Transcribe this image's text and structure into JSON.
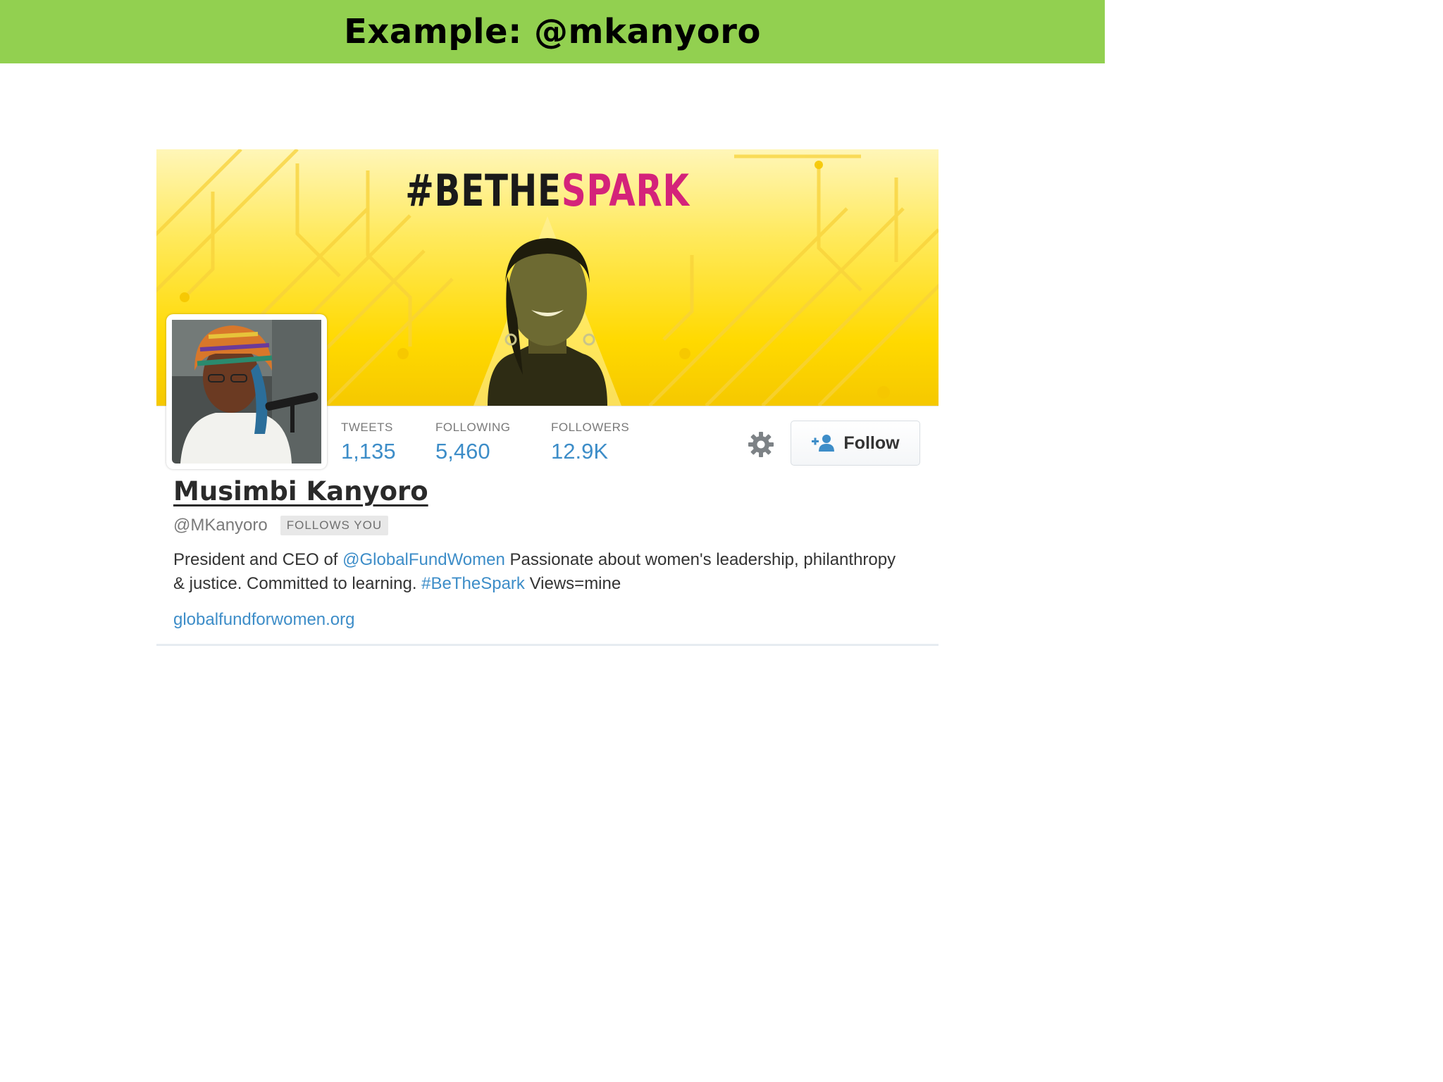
{
  "slide": {
    "title": "Example: @mkanyoro",
    "title_bar_color": "#92d050"
  },
  "banner": {
    "hashtag_dark": "#BETHE",
    "hashtag_pink": "SPARK",
    "colors": {
      "yellow": "#ffd900",
      "pink": "#d4237a"
    }
  },
  "stats": {
    "tweets": {
      "label": "TWEETS",
      "value": "1,135"
    },
    "following": {
      "label": "FOLLOWING",
      "value": "5,460"
    },
    "followers": {
      "label": "FOLLOWERS",
      "value": "12.9K"
    }
  },
  "actions": {
    "settings_icon": "gear-icon",
    "follow_icon": "add-user-icon",
    "follow_label": "Follow"
  },
  "profile": {
    "name": "Musimbi Kanyoro",
    "handle": "@MKanyoro",
    "follows_you": "FOLLOWS YOU",
    "bio": {
      "text_1": "President and CEO of ",
      "mention": "@GlobalFundWomen",
      "text_2": " Passionate about women's leadership, philanthropy & justice. Committed to learning. ",
      "hashtag": "#BeTheSpark",
      "text_3": " Views=mine"
    },
    "website": "globalfundforwomen.org",
    "link_color": "#3d8dc8"
  }
}
